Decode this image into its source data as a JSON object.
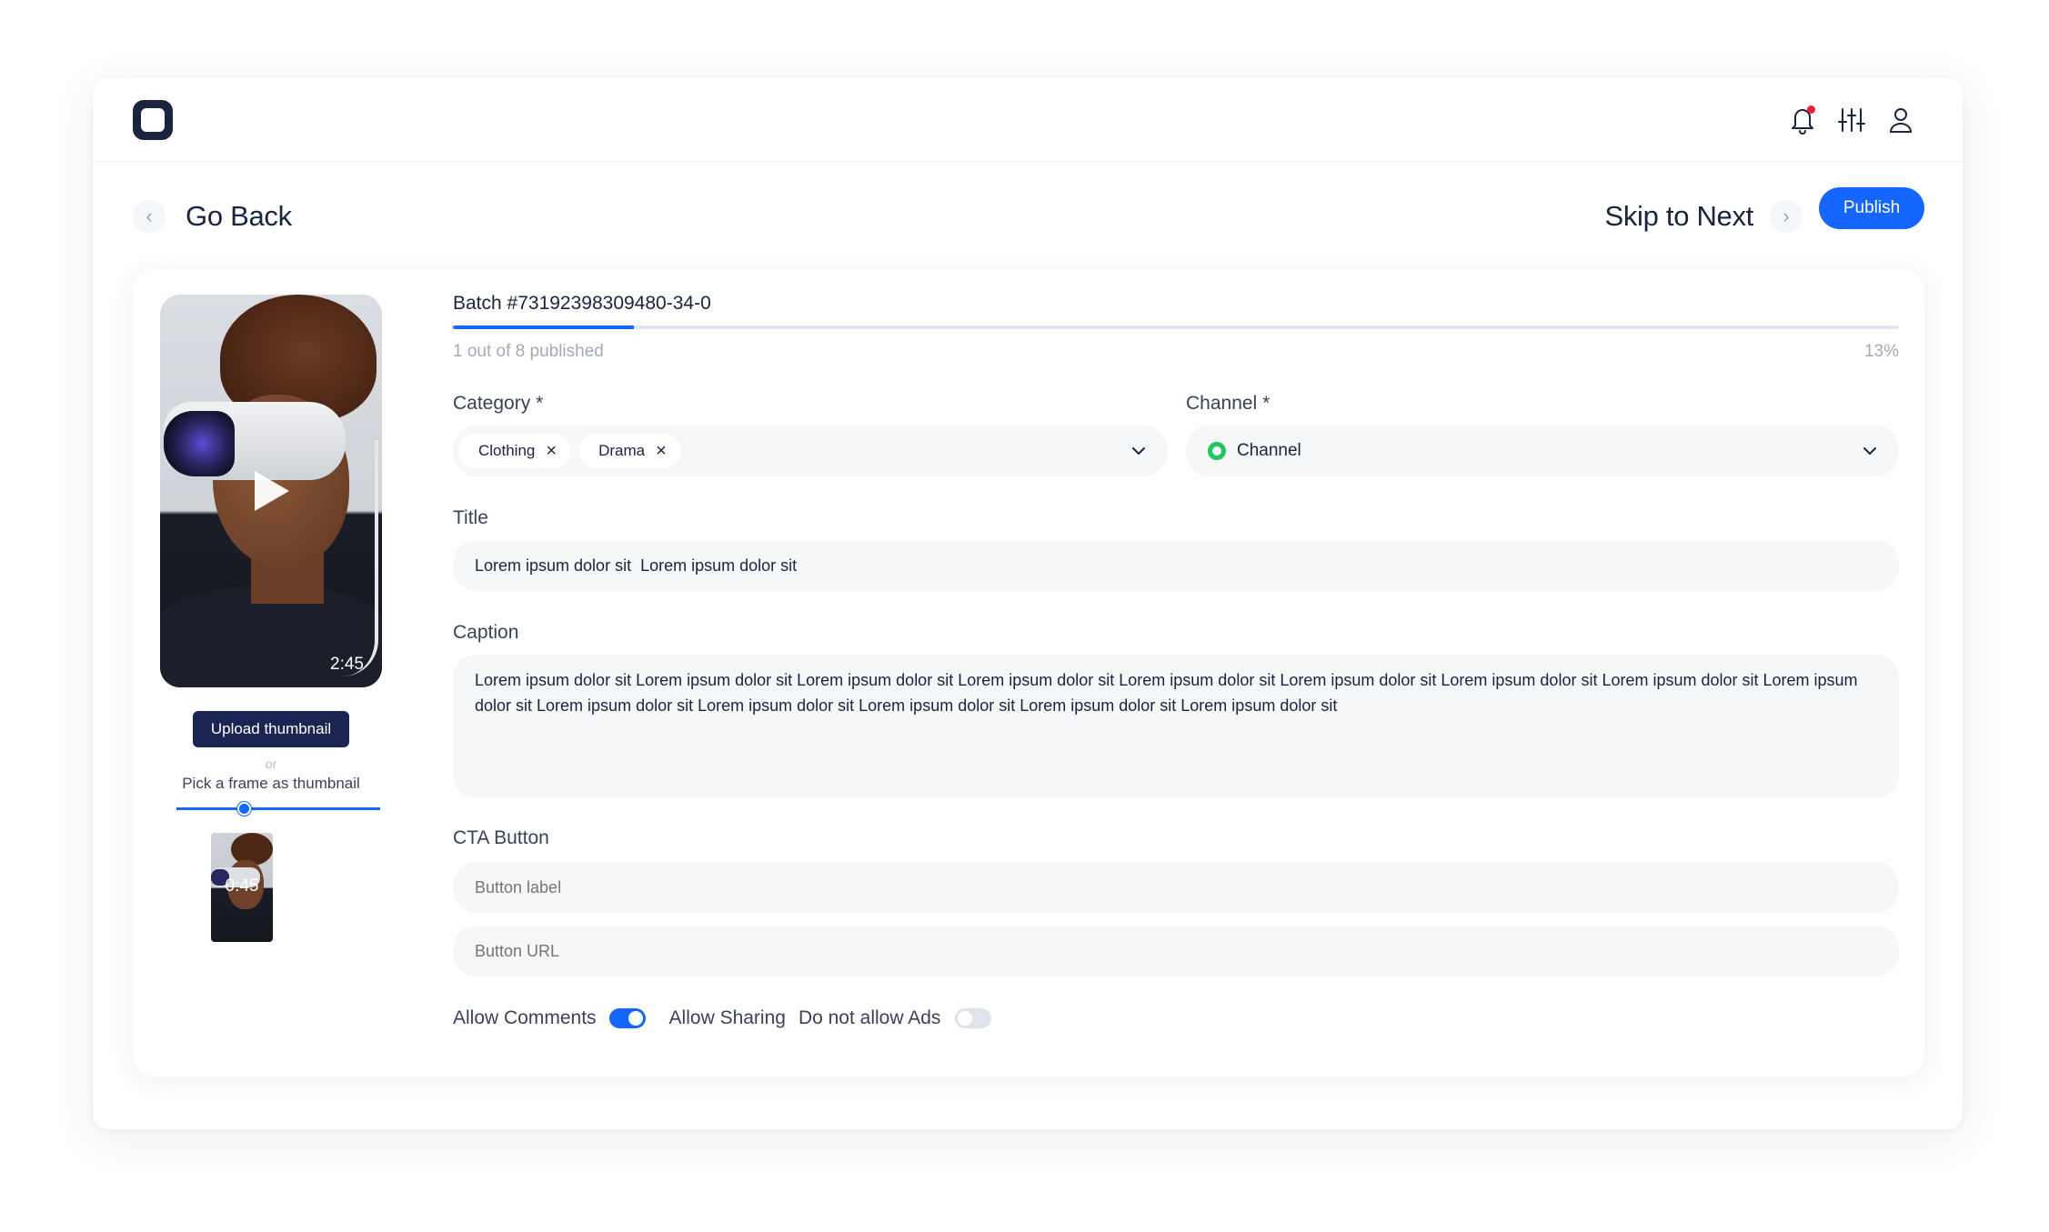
{
  "header": {
    "logo_icon": "rounded-square-logo",
    "icons": [
      "bell-icon",
      "sliders-icon",
      "user-icon"
    ],
    "notification_dot_color": "#e5233b"
  },
  "nav": {
    "back_label": "Go Back",
    "next_label": "Skip to Next",
    "publish_label": "Publish"
  },
  "colors": {
    "accent": "#1565ff",
    "dark_navy": "#1a2553",
    "channel_status": "#22c55e"
  },
  "media": {
    "duration": "2:45",
    "upload_label": "Upload thumbnail",
    "or_label": "or",
    "pick_frame_label": "Pick a frame as thumbnail",
    "frame_position": 0.32,
    "frame_time": "0:45"
  },
  "batch": {
    "title": "Batch #73192398309480-34-0",
    "progress_text": "1 out of 8 published",
    "progress_percent_label": "13%",
    "progress_fraction": 0.125
  },
  "form": {
    "category": {
      "label": "Category",
      "required_mark": "*",
      "chips": [
        "Clothing",
        "Drama"
      ]
    },
    "channel": {
      "label": "Channel",
      "required_mark": "*",
      "value": "Channel"
    },
    "title": {
      "label": "Title",
      "value": "Lorem ipsum dolor sit  Lorem ipsum dolor sit"
    },
    "caption": {
      "label": "Caption",
      "value": "Lorem ipsum dolor sit  Lorem ipsum dolor sit  Lorem ipsum dolor sit  Lorem ipsum dolor sit Lorem ipsum dolor sit  Lorem ipsum dolor sit  Lorem ipsum dolor sit  Lorem ipsum dolor sit  Lorem ipsum dolor sit  Lorem ipsum dolor sit  Lorem ipsum dolor sit  Lorem ipsum dolor sit  Lorem ipsum dolor sit  Lorem ipsum dolor sit"
    },
    "cta": {
      "label": "CTA Button",
      "label_placeholder": "Button label",
      "url_placeholder": "Button URL"
    },
    "toggles": {
      "allow_comments_label": "Allow Comments",
      "allow_comments_on": true,
      "allow_sharing_label": "Allow Sharing",
      "no_ads_label": "Do not allow Ads",
      "no_ads_on": false
    }
  }
}
